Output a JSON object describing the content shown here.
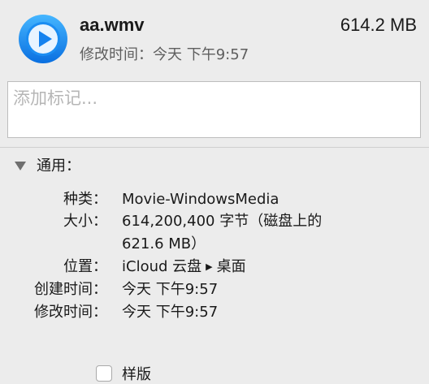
{
  "header": {
    "file_name": "aa.wmv",
    "file_size": "614.2 MB",
    "modified": "修改时间：今天 下午9:57",
    "icon": "media-player-play-icon"
  },
  "tags": {
    "placeholder": "添加标记..."
  },
  "general": {
    "title": "通用：",
    "kind_label": "种类：",
    "kind_value": "Movie-WindowsMedia",
    "size_label": "大小：",
    "size_value_line1": "614,200,400 字节（磁盘上的",
    "size_value_line2": "621.6 MB）",
    "where_label": "位置：",
    "where_part1": "iCloud 云盘",
    "where_part2": "桌面",
    "created_label": "创建时间：",
    "created_value": "今天 下午9:57",
    "modified_label": "修改时间：",
    "modified_value": "今天 下午9:57",
    "stationery_label": "样版"
  },
  "colors": {
    "accent": "#1a8cf0",
    "window_bg": "#ececec"
  }
}
